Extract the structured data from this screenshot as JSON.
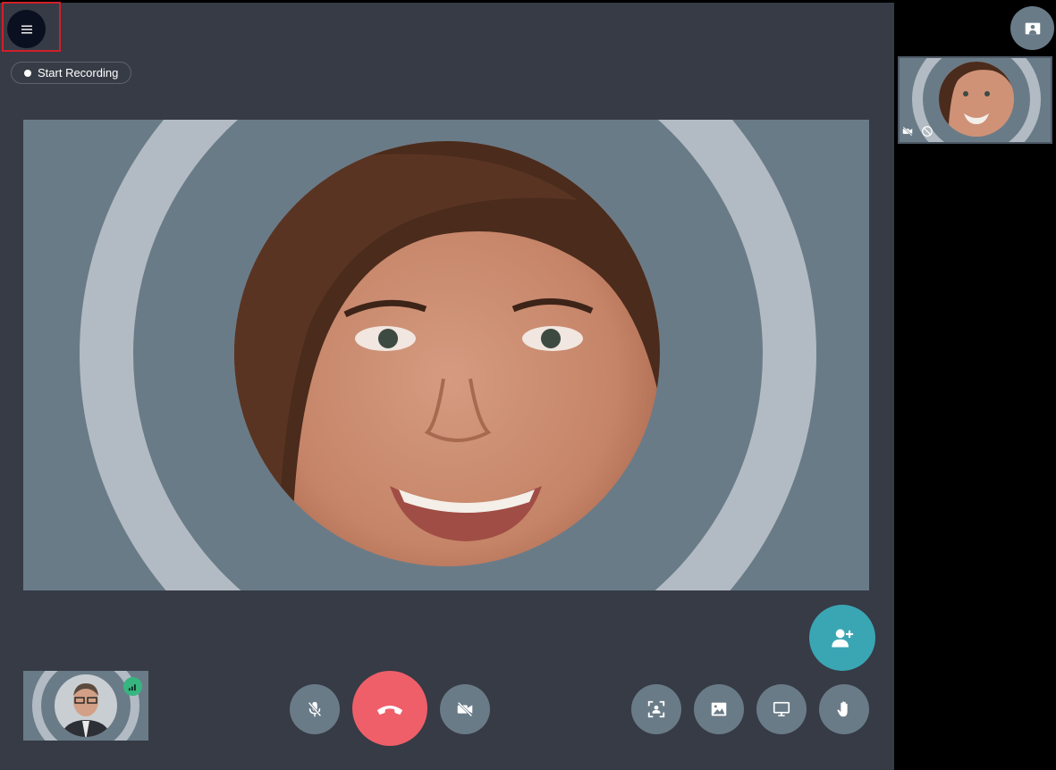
{
  "recording": {
    "label": "Start Recording"
  },
  "icons": {
    "menu": "hamburger-menu-icon",
    "mute": "microphone-off-icon",
    "hangup": "phone-hangup-icon",
    "camera": "camera-off-icon",
    "fullscreen": "focus-frame-icon",
    "background": "image-icon",
    "screenshare": "monitor-icon",
    "raise_hand": "hand-icon",
    "add_participant": "add-person-icon",
    "layout": "layout-toggle-icon",
    "signal": "signal-bars-icon"
  },
  "colors": {
    "stage": "#363b45",
    "tile": "#6a7b88",
    "ring": "#b2bbc3",
    "hangup": "#ef5f69",
    "add_participant": "#3aa6b4",
    "signal": "#37b580",
    "highlight": "#d0202a"
  }
}
